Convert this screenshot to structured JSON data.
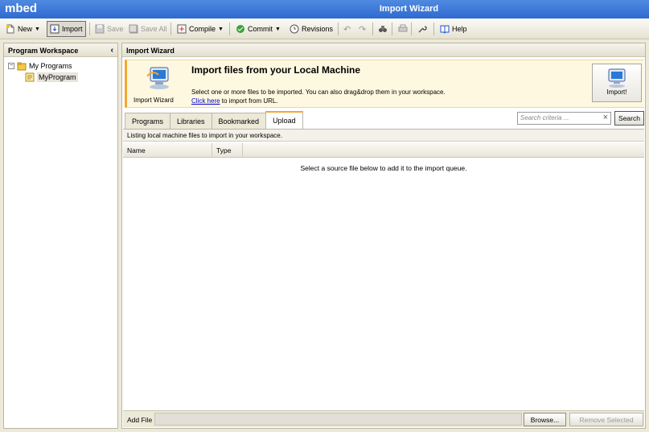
{
  "app": {
    "brand": "mbed",
    "window_title": "Import Wizard"
  },
  "toolbar": {
    "new": "New",
    "import": "Import",
    "save": "Save",
    "save_all": "Save All",
    "compile": "Compile",
    "commit": "Commit",
    "revisions": "Revisions",
    "help": "Help"
  },
  "sidebar": {
    "title": "Program Workspace",
    "tree": {
      "root": "My Programs",
      "child": "MyProgram"
    }
  },
  "main": {
    "title": "Import Wizard",
    "banner": {
      "icon_label": "Import Wizard",
      "heading": "Import files from your Local Machine",
      "desc_line1": "Select one or more files to be imported. You can also drag&drop them in your workspace.",
      "link_text": "Click here",
      "desc_line2_rest": " to import from URL.",
      "import_button": "Import!"
    },
    "tabs": [
      {
        "label": "Programs"
      },
      {
        "label": "Libraries"
      },
      {
        "label": "Bookmarked"
      },
      {
        "label": "Upload"
      }
    ],
    "search": {
      "placeholder": "Search criteria ...",
      "button": "Search"
    },
    "info_text": "Listing local machine files to import in your workspace.",
    "columns": [
      "Name",
      "Type"
    ],
    "empty_message": "Select a source file below to add it to the import queue.",
    "footer": {
      "add_file_label": "Add File",
      "browse_button": "Browse...",
      "remove_button": "Remove Selected"
    }
  },
  "colors": {
    "titlebar": "#2f6ad0",
    "accent": "#f0a830",
    "link": "#0000cc"
  }
}
